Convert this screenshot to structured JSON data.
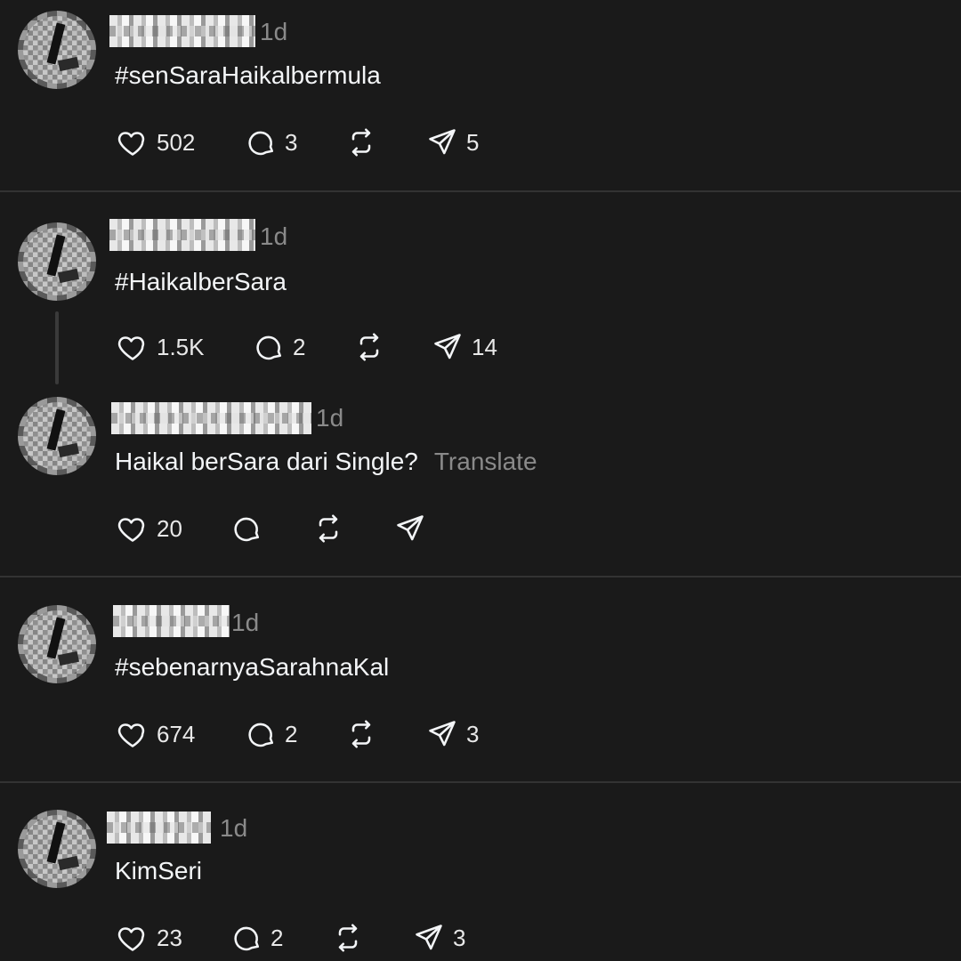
{
  "posts": [
    {
      "time": "1d",
      "text": "#senSaraHaikalbermula",
      "likes": "502",
      "replies": "3",
      "reposts": "",
      "shares": "5"
    },
    {
      "time": "1d",
      "text": "#HaikalberSara",
      "likes": "1.5K",
      "replies": "2",
      "reposts": "",
      "shares": "14"
    },
    {
      "time": "1d",
      "text": "Haikal berSara dari Single?",
      "translate_label": "Translate",
      "likes": "20",
      "replies": "",
      "reposts": "",
      "shares": ""
    },
    {
      "time": "1d",
      "text": "#sebenarnyaSarahnaKal",
      "likes": "674",
      "replies": "2",
      "reposts": "",
      "shares": "3"
    },
    {
      "time": "1d",
      "text": "KimSeri",
      "likes": "23",
      "replies": "2",
      "reposts": "",
      "shares": "3"
    }
  ],
  "icons": {
    "like": "heart-icon",
    "reply": "comment-icon",
    "repost": "repost-icon",
    "share": "send-icon"
  }
}
